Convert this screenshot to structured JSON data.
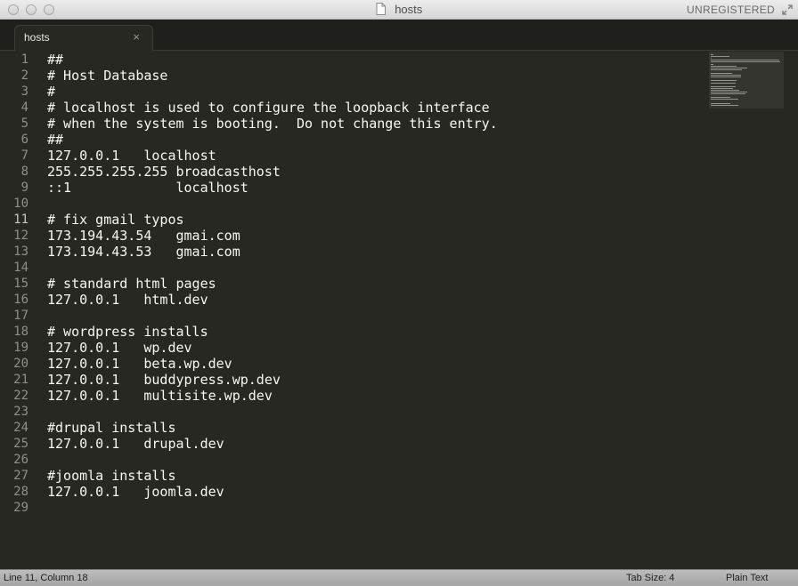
{
  "window": {
    "title": "hosts",
    "badge": "UNREGISTERED"
  },
  "tab": {
    "label": "hosts",
    "close_glyph": "×"
  },
  "editor": {
    "current_line": 11,
    "lines": [
      "##",
      "# Host Database",
      "#",
      "# localhost is used to configure the loopback interface",
      "# when the system is booting.  Do not change this entry.",
      "##",
      "127.0.0.1   localhost",
      "255.255.255.255 broadcasthost",
      "::1             localhost",
      "",
      "# fix gmail typos",
      "173.194.43.54   gmai.com",
      "173.194.43.53   gmai.com",
      "",
      "# standard html pages",
      "127.0.0.1   html.dev",
      "",
      "# wordpress installs",
      "127.0.0.1   wp.dev",
      "127.0.0.1   beta.wp.dev",
      "127.0.0.1   buddypress.wp.dev",
      "127.0.0.1   multisite.wp.dev",
      "",
      "#drupal installs",
      "127.0.0.1   drupal.dev",
      "",
      "#joomla installs",
      "127.0.0.1   joomla.dev",
      ""
    ]
  },
  "statusbar": {
    "position": "Line 11, Column 18",
    "tab_size": "Tab Size: 4",
    "syntax": "Plain Text"
  },
  "colors": {
    "editor_bg": "#272822",
    "text": "#f8f8f2",
    "gutter_text": "#8f908a"
  },
  "icons": {
    "doc": "document-icon",
    "fullscreen": "fullscreen-icon",
    "close": "close-icon"
  }
}
